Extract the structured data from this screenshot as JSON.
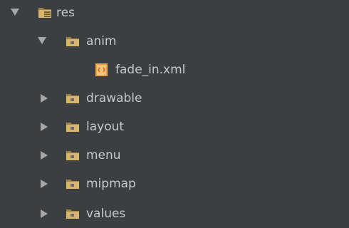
{
  "tree": {
    "items": [
      {
        "label": "res",
        "expanded": true,
        "icon": "resource-folder-icon"
      },
      {
        "label": "anim",
        "expanded": true,
        "icon": "folder-icon"
      },
      {
        "label": "fade_in.xml",
        "icon": "xml-file-icon"
      },
      {
        "label": "drawable",
        "expanded": false,
        "icon": "folder-icon"
      },
      {
        "label": "layout",
        "expanded": false,
        "icon": "folder-icon"
      },
      {
        "label": "menu",
        "expanded": false,
        "icon": "folder-icon"
      },
      {
        "label": "mipmap",
        "expanded": false,
        "icon": "folder-icon"
      },
      {
        "label": "values",
        "expanded": false,
        "icon": "folder-icon"
      }
    ]
  },
  "colors": {
    "background": "#3c3f41",
    "text": "#c8c8c8",
    "arrow": "#a7a7a7",
    "folder": "#d8b56b",
    "folder_dark": "#9f8244",
    "xml_icon": "#f0a24b"
  }
}
